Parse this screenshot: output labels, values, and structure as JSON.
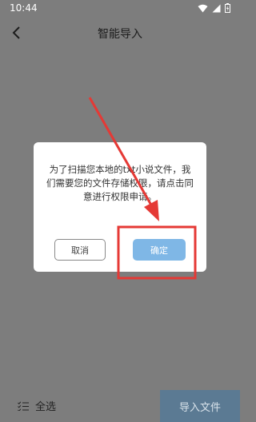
{
  "status_bar": {
    "time": "10:44",
    "icons": [
      "wifi-icon",
      "signal-icon",
      "battery-icon"
    ]
  },
  "header": {
    "title": "智能导入",
    "back_icon": "chevron-left-icon"
  },
  "dialog": {
    "message": "为了扫描您本地的txt小说文件，我们需要您的文件存储权限，请点击同意进行权限申请。",
    "cancel_label": "取消",
    "confirm_label": "确定"
  },
  "bottom_bar": {
    "select_all_label": "全选",
    "import_label": "导入文件"
  },
  "colors": {
    "scrim": "#7d7d7d",
    "confirm_button": "#7fb7e6",
    "import_button": "#5b7a93",
    "annotation": "#e53935"
  }
}
